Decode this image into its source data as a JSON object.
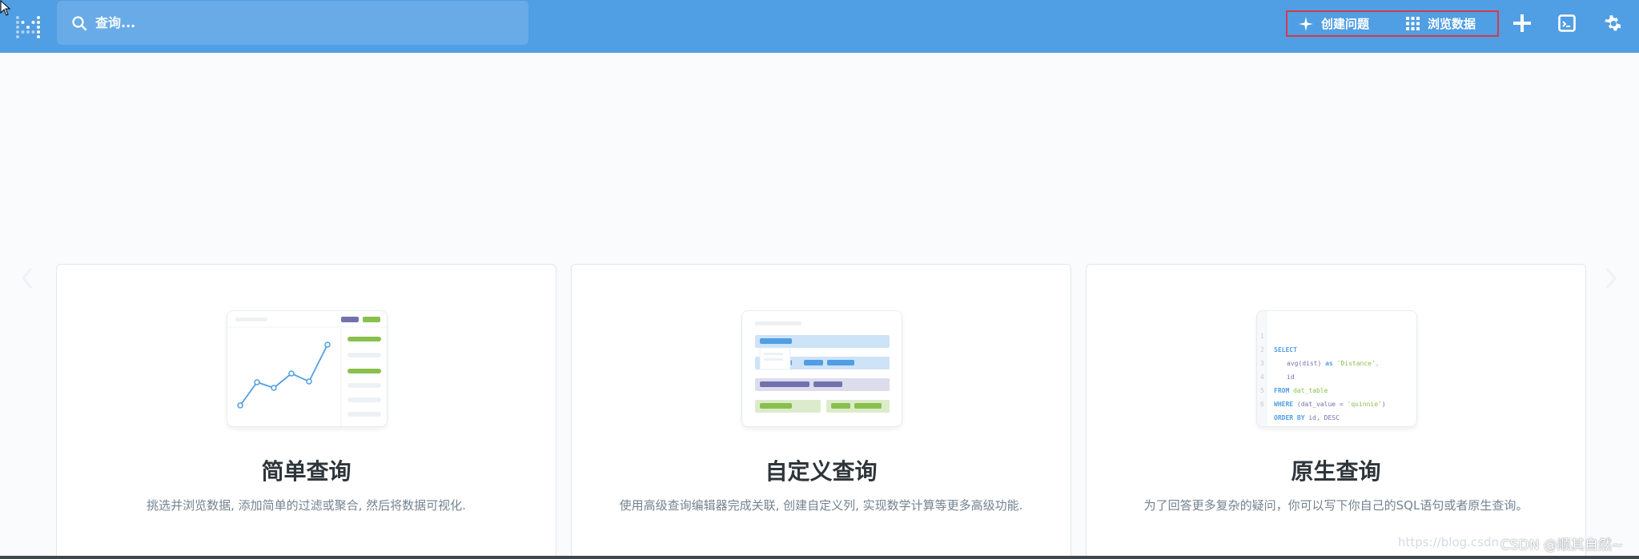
{
  "topbar": {
    "search_placeholder": "查询...",
    "create_question": "创建问题",
    "browse_data": "浏览数据",
    "icons": [
      "metabase-logo-icon",
      "search-icon",
      "sparkle-icon",
      "grid-icon",
      "plus-icon",
      "sql-editor-icon",
      "gear-icon"
    ],
    "color": "#509ee3"
  },
  "cards": [
    {
      "title": "简单查询",
      "description": "挑选并浏览数据, 添加简单的过滤或聚合, 然后将数据可视化."
    },
    {
      "title": "自定义查询",
      "description": "使用高级查询编辑器完成关联, 创建自定义列, 实现数学计算等更多高级功能."
    },
    {
      "title": "原生查询",
      "description": "为了回答更多复杂的疑问，你可以写下你自己的SQL语句或者原生查询。"
    }
  ],
  "sql_sample": {
    "line_numbers": [
      "1",
      "2",
      "3",
      "4",
      "5",
      "6"
    ],
    "line1": "SELECT",
    "line2_fn": "avg(dist)",
    "line2_kw": " as ",
    "line2_str": "'Distance',",
    "line3": "id",
    "line4_kw": "FROM ",
    "line4_tbl": "dat_table",
    "line5_kw": "WHERE ",
    "line5_cond": "(dat_value = ",
    "line5_str": "'quinnie'",
    "line5_end": ")",
    "line6_kw": "ORDER BY ",
    "line6_rest": "id, DESC"
  },
  "watermark": {
    "url": "https://blog.csdn",
    "author": "CSDN @顺其自然~"
  },
  "colors": {
    "brand": "#509ee3",
    "accent_green": "#88bf4d",
    "accent_purple": "#7172ad",
    "highlight": "#d8384b"
  }
}
